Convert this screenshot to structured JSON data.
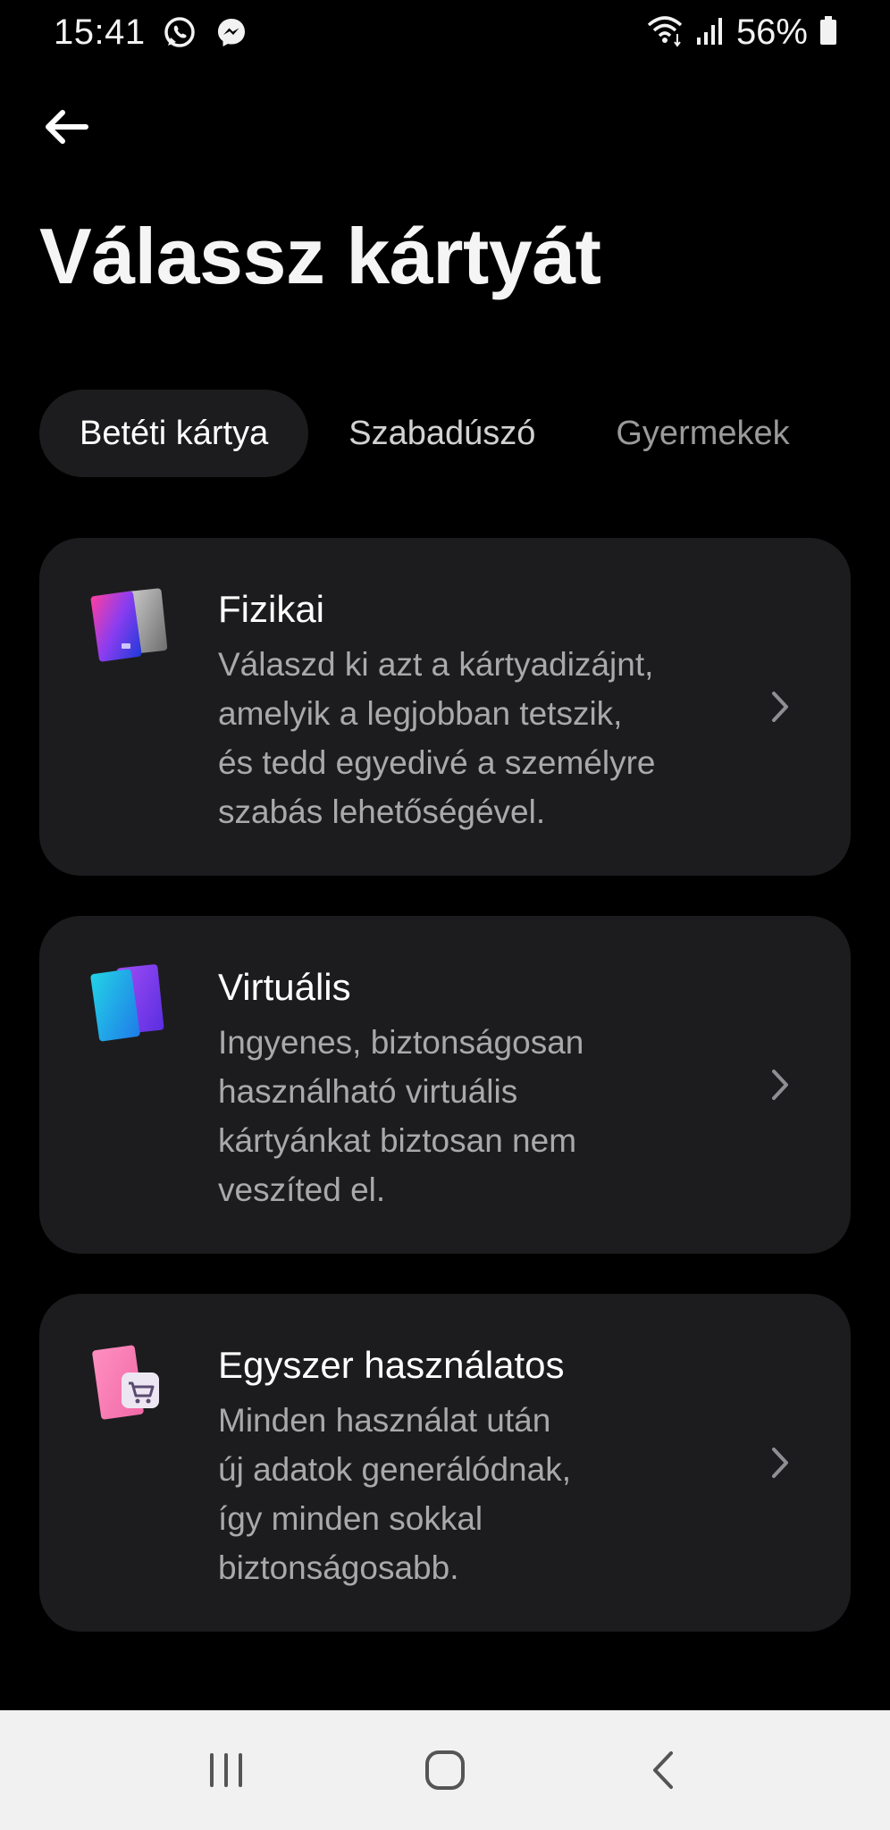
{
  "status_bar": {
    "time": "15:41",
    "battery": "56%",
    "icons": [
      "whatsapp-icon",
      "messenger-icon",
      "wifi-icon",
      "signal-icon",
      "battery-icon"
    ]
  },
  "header": {
    "back_icon": "arrow-left-icon",
    "title": "Válassz kártyát"
  },
  "tabs": [
    {
      "label": "Betéti kártya",
      "active": true
    },
    {
      "label": "Szabadúszó",
      "active": false
    },
    {
      "label": "Gyermekek",
      "active": false
    }
  ],
  "options": [
    {
      "title": "Fizikai",
      "desc_lines": [
        "Válaszd ki azt a kártyadizájnt,",
        "amelyik a legjobban tetszik,",
        "és tedd egyedivé a személyre",
        "szabás lehetőségével."
      ],
      "icon": "physical-card-icon"
    },
    {
      "title": "Virtuális",
      "desc_lines": [
        "Ingyenes, biztonságosan",
        "használható virtuális",
        "kártyánkat biztosan nem",
        "veszíted el."
      ],
      "icon": "virtual-card-icon"
    },
    {
      "title": "Egyszer használatos",
      "desc_lines": [
        "Minden használat után",
        "új adatok generálódnak,",
        "így minden sokkal",
        "biztonságosabb."
      ],
      "icon": "single-use-card-icon"
    }
  ],
  "nav_bar": {
    "icons": [
      "recents-icon",
      "home-icon",
      "back-icon"
    ]
  },
  "colors": {
    "background": "#000000",
    "card": "#1c1c1e",
    "text_primary": "#ffffff",
    "text_secondary": "#a9a9ab",
    "nav_bar": "#f1f1f1"
  }
}
